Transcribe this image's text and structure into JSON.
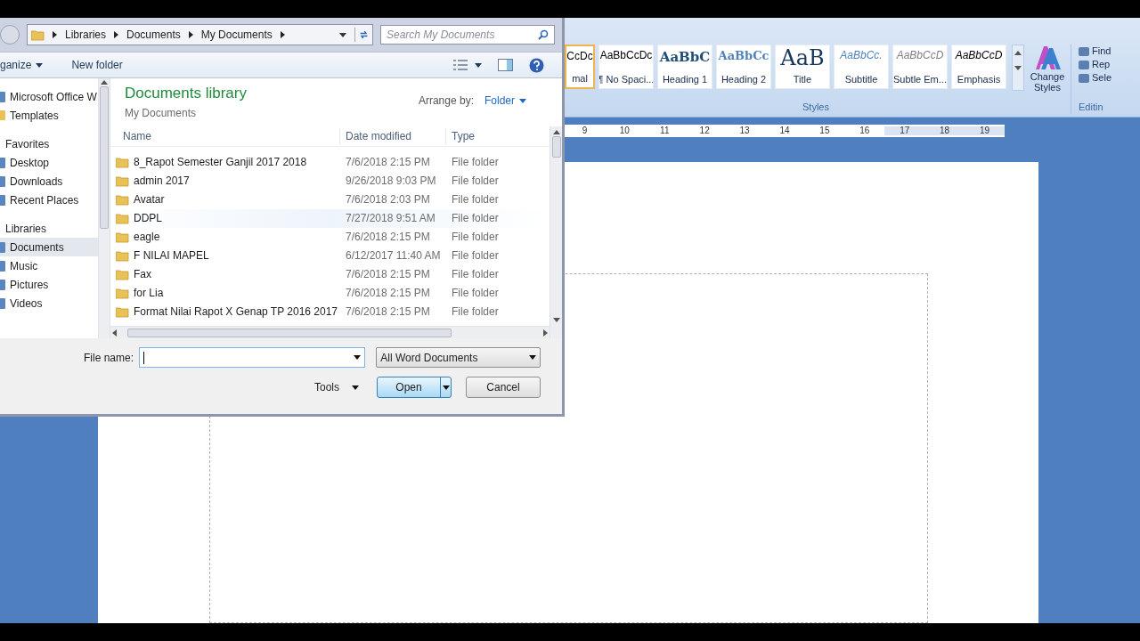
{
  "word": {
    "styles": [
      {
        "preview": "CcDc",
        "label": "mal",
        "kind": "normal",
        "selected": true
      },
      {
        "preview": "AaBbCcDc",
        "label": "¶ No Spaci...",
        "kind": "normal",
        "selected": false
      },
      {
        "preview": "AaBbC",
        "label": "Heading 1",
        "kind": "heading1",
        "selected": false
      },
      {
        "preview": "AaBbCc",
        "label": "Heading 2",
        "kind": "heading2",
        "selected": false
      },
      {
        "preview": "AaB",
        "label": "Title",
        "kind": "title",
        "selected": false
      },
      {
        "preview": "AaBbCc.",
        "label": "Subtitle",
        "kind": "subtitle",
        "selected": false
      },
      {
        "preview": "AaBbCcD",
        "label": "Subtle Em...",
        "kind": "subtle",
        "selected": false
      },
      {
        "preview": "AaBbCcD",
        "label": "Emphasis",
        "kind": "emphasis",
        "selected": false
      }
    ],
    "change_styles": "Change Styles",
    "styles_group": "Styles",
    "editing": [
      "Find",
      "Rep",
      "Sele"
    ],
    "editing_group": "Editin",
    "ruler": [
      "9",
      "10",
      "11",
      "12",
      "13",
      "14",
      "15",
      "16",
      "17",
      "18",
      "19"
    ]
  },
  "dialog": {
    "breadcrumbs": [
      "Libraries",
      "Documents",
      "My Documents"
    ],
    "search": {
      "placeholder": "Search My Documents"
    },
    "toolbar": {
      "organize": "ganize",
      "new_folder": "New folder"
    },
    "nav": [
      {
        "label": "Microsoft Office W",
        "kind": "item",
        "selected": false
      },
      {
        "label": "Templates",
        "kind": "folder",
        "selected": false
      },
      {
        "label": "Favorites",
        "kind": "header",
        "selected": false
      },
      {
        "label": "Desktop",
        "kind": "item",
        "selected": false
      },
      {
        "label": "Downloads",
        "kind": "item",
        "selected": false
      },
      {
        "label": "Recent Places",
        "kind": "item",
        "selected": false
      },
      {
        "label": "Libraries",
        "kind": "header",
        "selected": false
      },
      {
        "label": "Documents",
        "kind": "item",
        "selected": true
      },
      {
        "label": "Music",
        "kind": "item",
        "selected": false
      },
      {
        "label": "Pictures",
        "kind": "item",
        "selected": false
      },
      {
        "label": "Videos",
        "kind": "item",
        "selected": false
      }
    ],
    "library": {
      "title": "Documents library",
      "subtitle": "My Documents",
      "arrange_label": "Arrange by:",
      "arrange_value": "Folder"
    },
    "columns": [
      "Name",
      "Date modified",
      "Type"
    ],
    "rows": [
      {
        "name": "8_Rapot Semester Ganjil 2017 2018",
        "date": "7/6/2018 2:15 PM",
        "type": "File folder",
        "hover": false
      },
      {
        "name": "admin 2017",
        "date": "9/26/2018 9:03 PM",
        "type": "File folder",
        "hover": false
      },
      {
        "name": "Avatar",
        "date": "7/6/2018 2:03 PM",
        "type": "File folder",
        "hover": false
      },
      {
        "name": "DDPL",
        "date": "7/27/2018 9:51 AM",
        "type": "File folder",
        "hover": true
      },
      {
        "name": "eagle",
        "date": "7/6/2018 2:15 PM",
        "type": "File folder",
        "hover": false
      },
      {
        "name": "F NILAI MAPEL",
        "date": "6/12/2017 11:40 AM",
        "type": "File folder",
        "hover": false
      },
      {
        "name": "Fax",
        "date": "7/6/2018 2:15 PM",
        "type": "File folder",
        "hover": false
      },
      {
        "name": "for Lia",
        "date": "7/6/2018 2:15 PM",
        "type": "File folder",
        "hover": false
      },
      {
        "name": "Format Nilai Rapot  X Genap TP 2016 2017",
        "date": "7/6/2018 2:15 PM",
        "type": "File folder",
        "hover": false
      }
    ],
    "file_name_label": "File name:",
    "filter": "All Word Documents",
    "tools": "Tools",
    "open": "Open",
    "cancel": "Cancel"
  }
}
